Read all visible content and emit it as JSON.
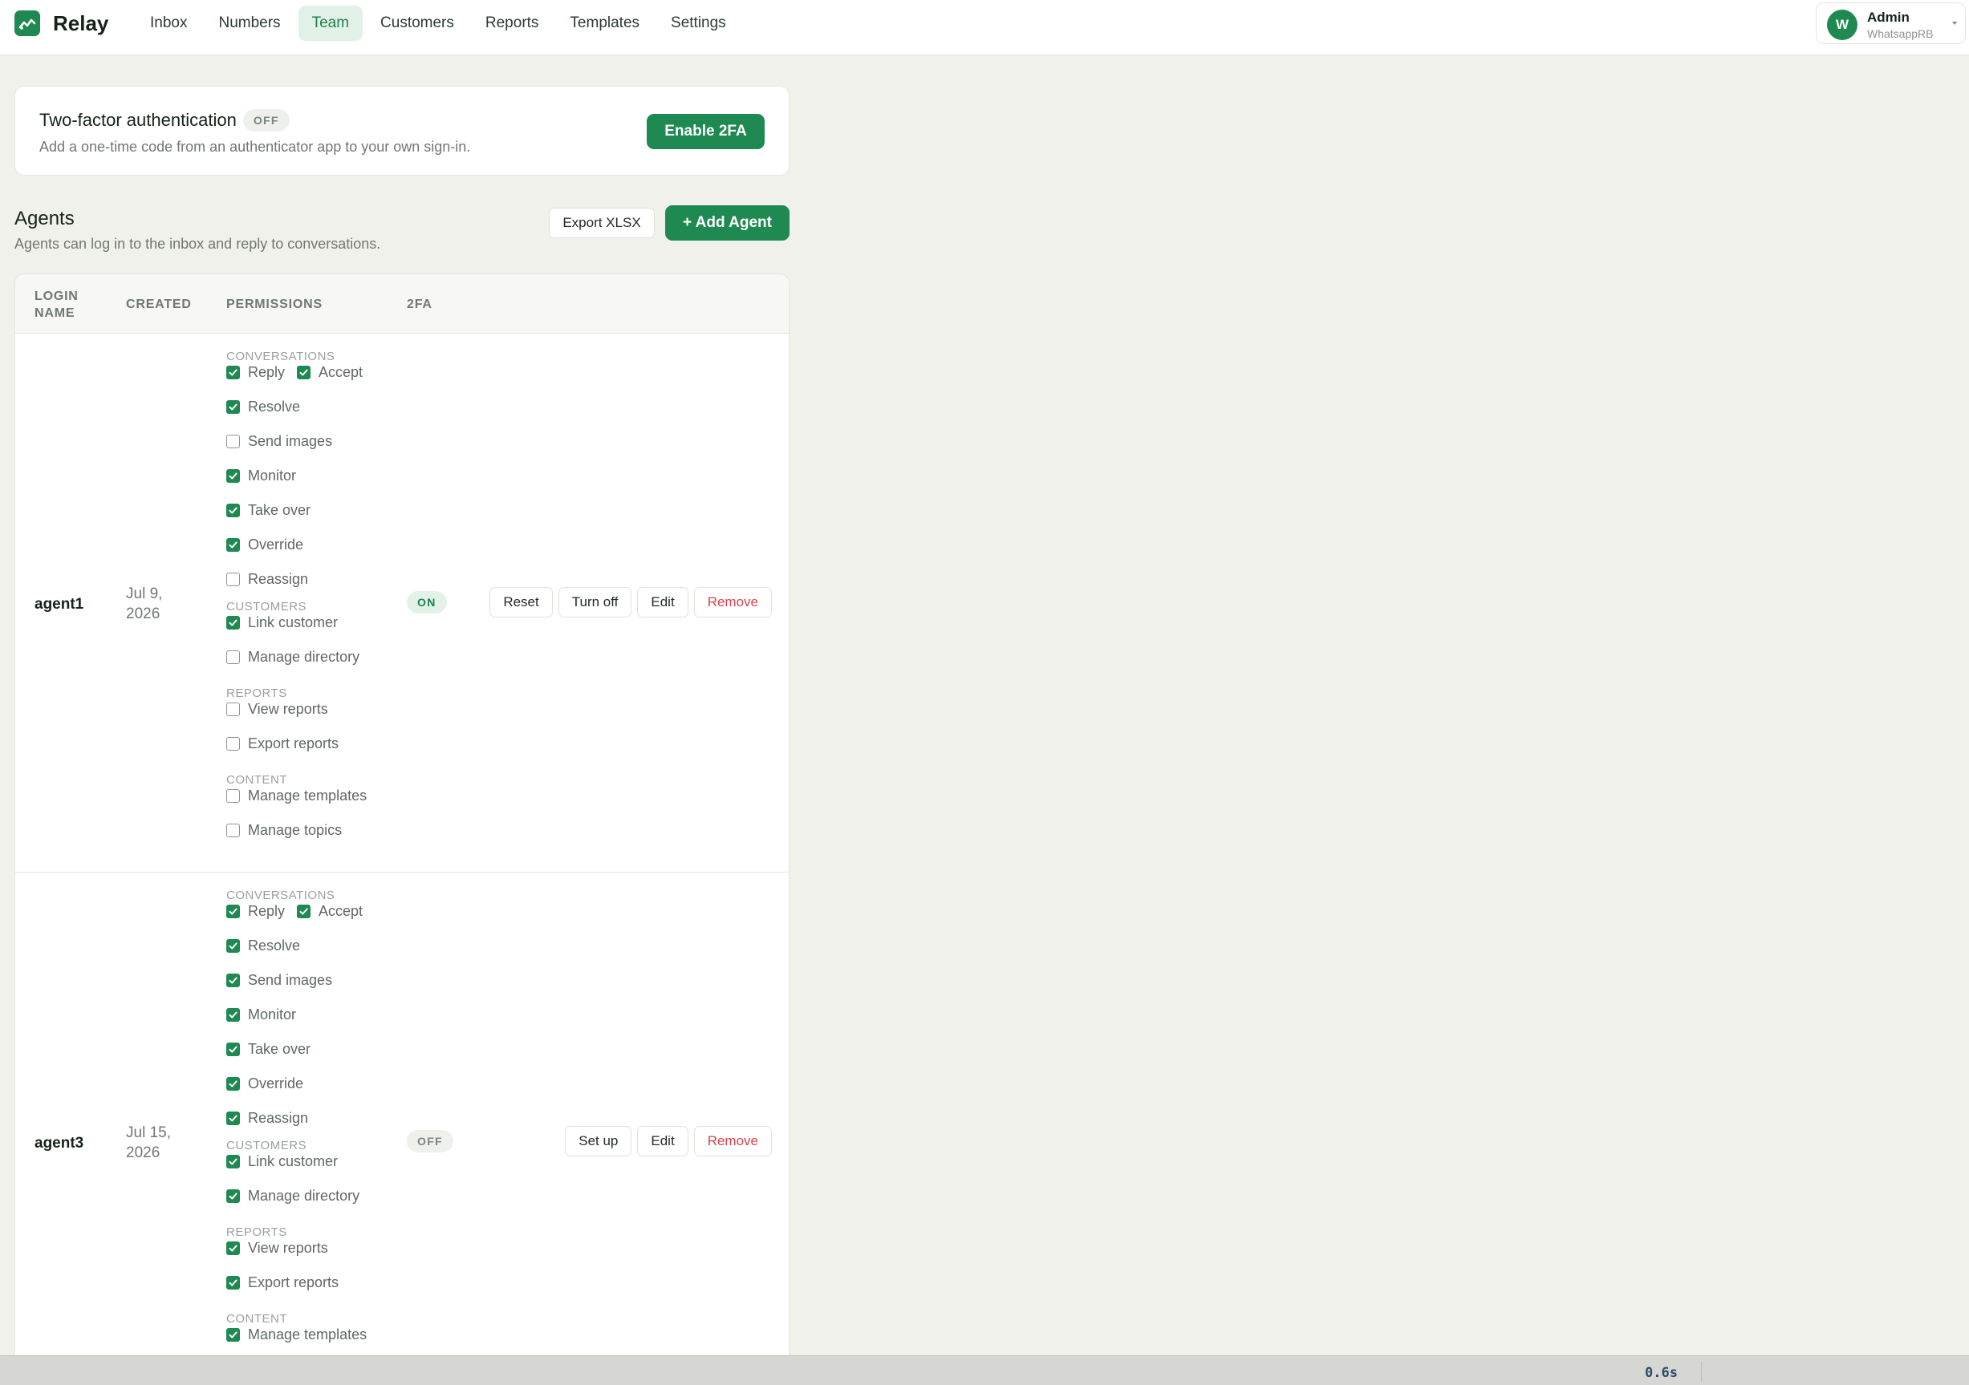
{
  "app": {
    "name": "Relay"
  },
  "nav": {
    "items": [
      {
        "label": "Inbox",
        "active": false
      },
      {
        "label": "Numbers",
        "active": false
      },
      {
        "label": "Team",
        "active": true
      },
      {
        "label": "Customers",
        "active": false
      },
      {
        "label": "Reports",
        "active": false
      },
      {
        "label": "Templates",
        "active": false
      },
      {
        "label": "Settings",
        "active": false
      }
    ]
  },
  "account": {
    "initial": "W",
    "name": "Admin",
    "org": "WhatsappRB"
  },
  "colors": {
    "accent": "#1e8a52",
    "danger": "#d8434b",
    "background": "#f1f1ec"
  },
  "two_factor": {
    "title": "Two-factor authentication",
    "status": "OFF",
    "description": "Add a one-time code from an authenticator app to your own sign-in.",
    "button": "Enable 2FA"
  },
  "agents": {
    "title": "Agents",
    "description": "Agents can log in to the inbox and reply to conversations.",
    "export_label": "Export XLSX",
    "add_label": "+ Add Agent",
    "columns": [
      "LOGIN NAME",
      "CREATED",
      "PERMISSIONS",
      "2FA"
    ],
    "groups": {
      "conversations": "CONVERSATIONS",
      "customers": "CUSTOMERS",
      "reports": "REPORTS",
      "content": "CONTENT"
    },
    "perm_labels": {
      "reply": "Reply",
      "accept": "Accept",
      "resolve": "Resolve",
      "send_images": "Send images",
      "monitor": "Monitor",
      "take_over": "Take over",
      "override": "Override",
      "reassign": "Reassign",
      "link_customer": "Link customer",
      "manage_directory": "Manage directory",
      "view_reports": "View reports",
      "export_reports": "Export reports",
      "manage_templates": "Manage templates",
      "manage_topics": "Manage topics"
    },
    "rows": [
      {
        "login": "agent1",
        "created": "Jul 9, 2026",
        "twofa": "ON",
        "perms": {
          "reply": true,
          "accept": true,
          "resolve": true,
          "send_images": false,
          "monitor": true,
          "take_over": true,
          "override": true,
          "reassign": false,
          "link_customer": true,
          "manage_directory": false,
          "view_reports": false,
          "export_reports": false,
          "manage_templates": false,
          "manage_topics": false
        },
        "actions": [
          "Reset",
          "Turn off",
          "Edit",
          "Remove"
        ]
      },
      {
        "login": "agent3",
        "created": "Jul 15, 2026",
        "twofa": "OFF",
        "perms": {
          "reply": true,
          "accept": true,
          "resolve": true,
          "send_images": true,
          "monitor": true,
          "take_over": true,
          "override": true,
          "reassign": true,
          "link_customer": true,
          "manage_directory": true,
          "view_reports": true,
          "export_reports": true,
          "manage_templates": true
        },
        "actions": [
          "Set up",
          "Edit",
          "Remove"
        ]
      }
    ]
  },
  "status_bar": {
    "text": "0.6s"
  }
}
